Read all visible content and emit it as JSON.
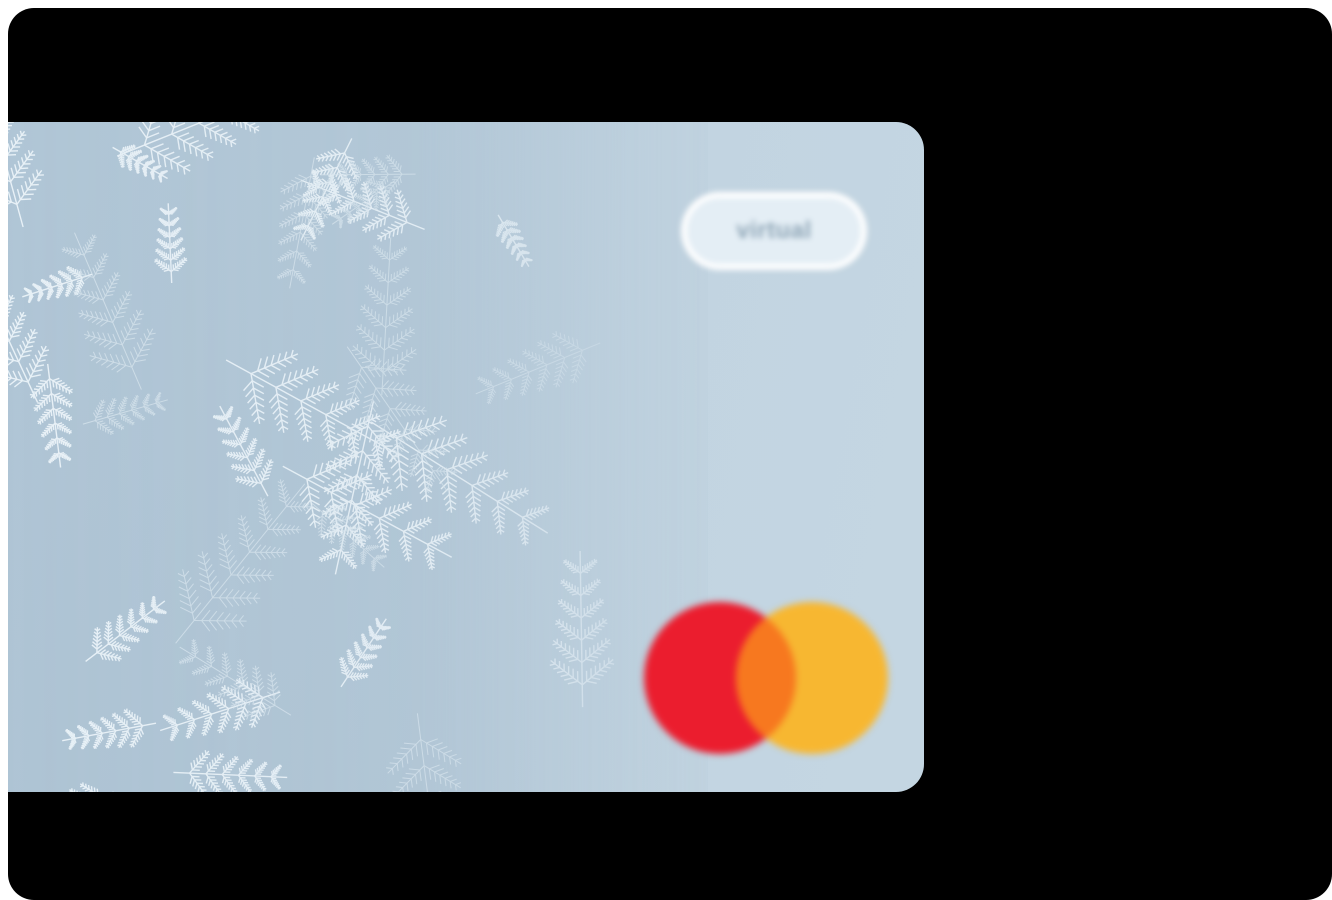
{
  "card": {
    "badge_label": "virtual",
    "background_pattern": "frost-crystals",
    "base_color": "#bfd2df",
    "network_logo": {
      "name": "mastercard-logo",
      "colors": {
        "left": "#eb1d2e",
        "right": "#f7b731",
        "overlap": "#f7781f"
      }
    }
  },
  "frame_color": "#000000"
}
